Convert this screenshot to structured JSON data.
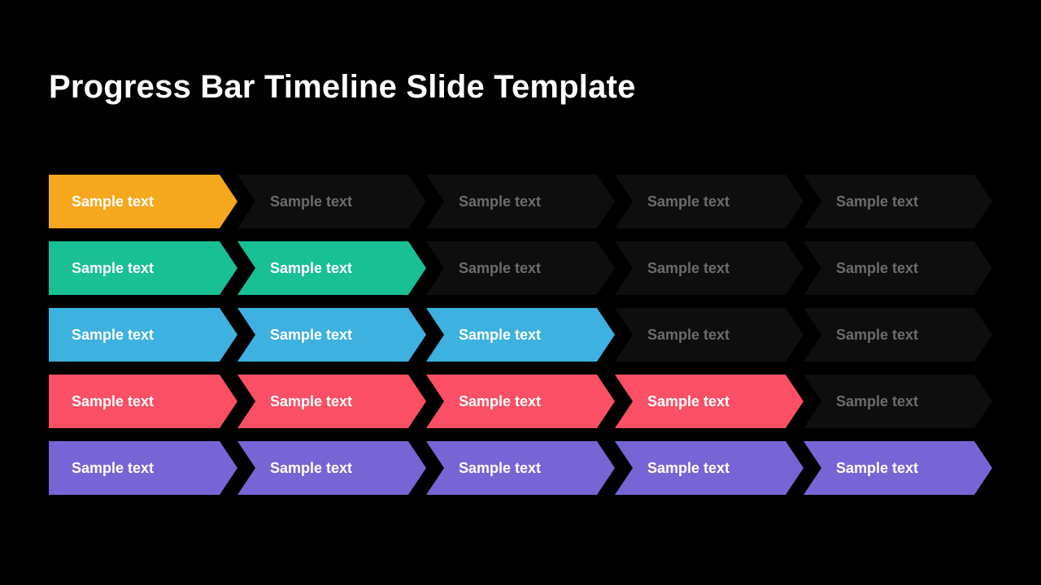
{
  "title": "Progress Bar Timeline Slide Template",
  "segment_label": "Sample text",
  "columns": 5,
  "colors": {
    "inactive_bg": "#0e0e0e",
    "inactive_text": "#6c6c6c",
    "active_text": "#ffffff"
  },
  "rows": [
    {
      "filled": 1,
      "color": "#f5a81e"
    },
    {
      "filled": 2,
      "color": "#18c094"
    },
    {
      "filled": 3,
      "color": "#3db1df"
    },
    {
      "filled": 4,
      "color": "#fa4f64"
    },
    {
      "filled": 5,
      "color": "#7765d6"
    }
  ],
  "layout": {
    "segment_width": 232,
    "segment_overlap": 0,
    "segment_gap": 0
  }
}
